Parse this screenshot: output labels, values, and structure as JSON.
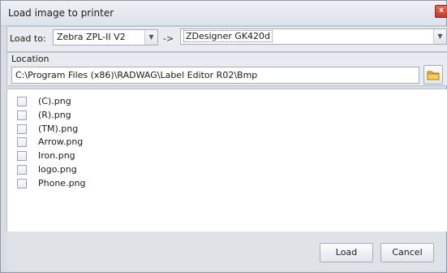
{
  "window": {
    "title": "Load image to printer",
    "close_glyph": "x"
  },
  "load_to": {
    "label": "Load to:",
    "source": "Zebra ZPL-II V2",
    "arrow": "->",
    "destination": "ZDesigner GK420d"
  },
  "location": {
    "label": "Location",
    "path": "C:\\Program Files (x86)\\RADWAG\\Label Editor R02\\Bmp"
  },
  "files": [
    "(C).png",
    "(R).png",
    "(TM).png",
    "Arrow.png",
    "Iron.png",
    "logo.png",
    "Phone.png"
  ],
  "buttons": {
    "load": "Load",
    "cancel": "Cancel"
  },
  "colors": {
    "close_red": "#c2392a",
    "folder_yellow": "#e8b23a"
  }
}
